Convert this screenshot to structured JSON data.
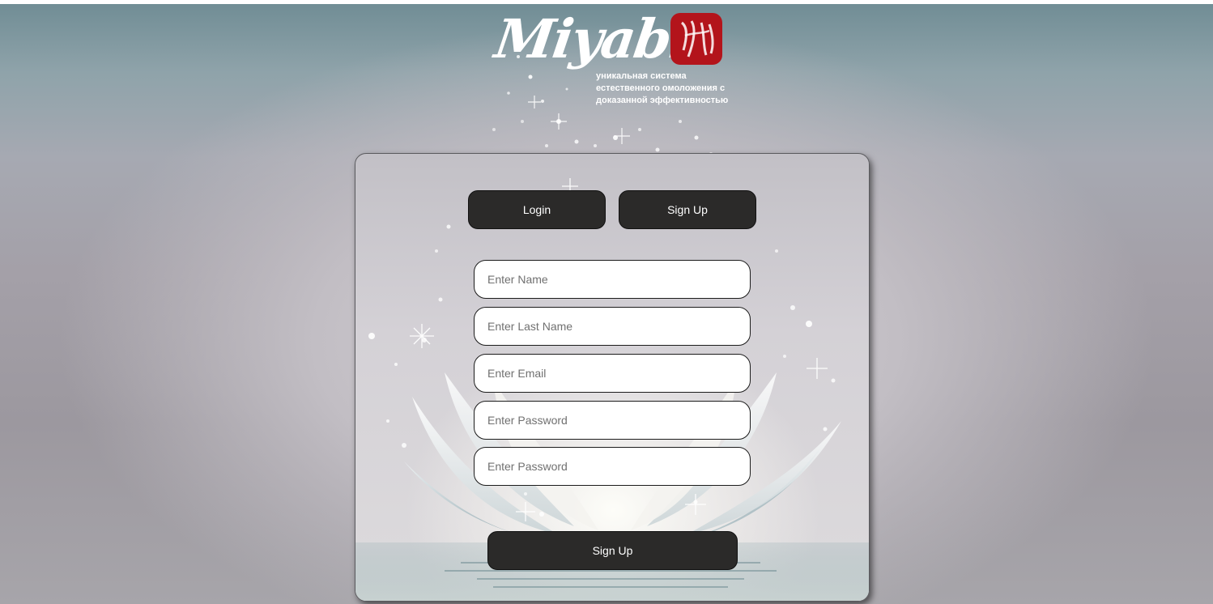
{
  "brand": {
    "wordmark": "Miyabi",
    "tagline": [
      "уникальная система",
      "естественного омоложения с",
      "доказанной эффективностью"
    ],
    "seal_color": "#b3141b"
  },
  "tabs": {
    "login_label": "Login",
    "signup_label": "Sign Up"
  },
  "form": {
    "name_placeholder": "Enter Name",
    "last_name_placeholder": "Enter Last Name",
    "email_placeholder": "Enter Email",
    "password_placeholder": "Enter Password",
    "confirm_password_placeholder": "Enter Password",
    "submit_label": "Sign Up"
  },
  "colors": {
    "button_bg": "#2b2a29",
    "button_text": "#ffffff",
    "field_border": "#1c1c1c"
  }
}
